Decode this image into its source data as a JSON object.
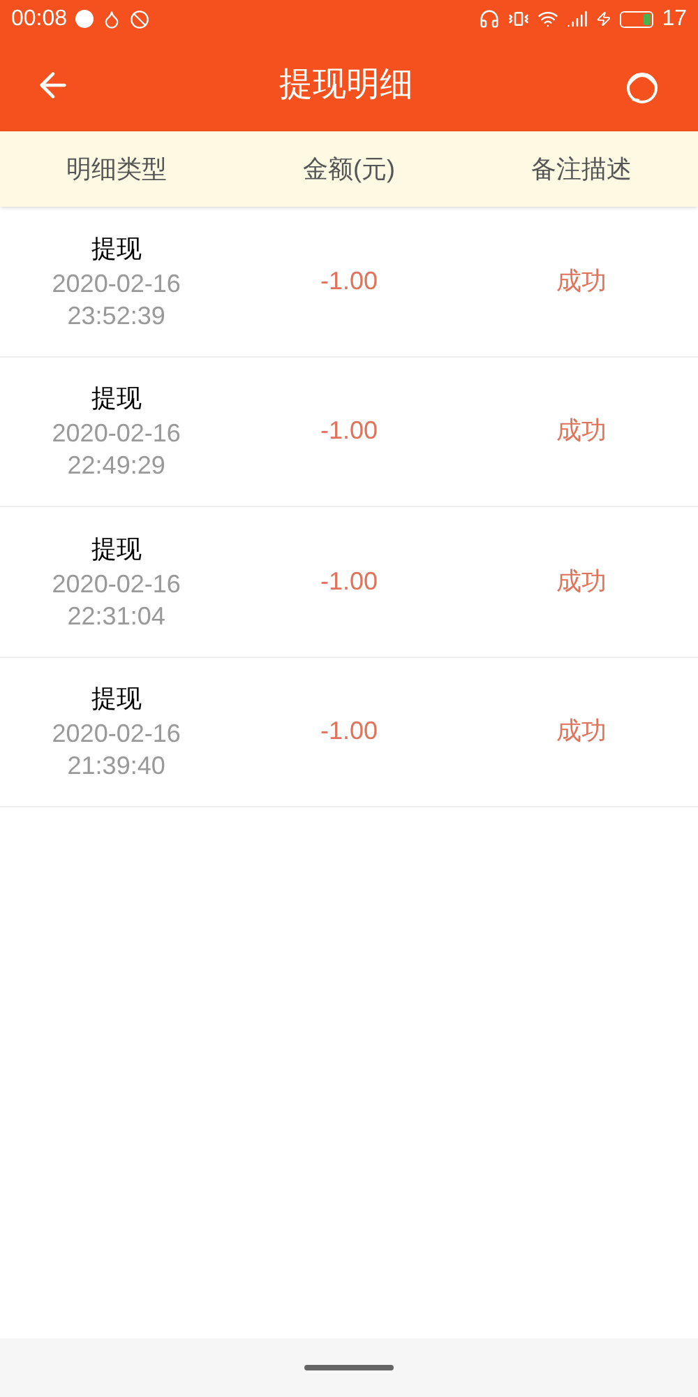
{
  "status_bar": {
    "time": "00:08",
    "battery": "17"
  },
  "header": {
    "title": "提现明细"
  },
  "table": {
    "columns": [
      "明细类型",
      "金额(元)",
      "备注描述"
    ],
    "rows": [
      {
        "type": "提现",
        "date": "2020-02-16",
        "time": "23:52:39",
        "amount": "-1.00",
        "note": "成功"
      },
      {
        "type": "提现",
        "date": "2020-02-16",
        "time": "22:49:29",
        "amount": "-1.00",
        "note": "成功"
      },
      {
        "type": "提现",
        "date": "2020-02-16",
        "time": "22:31:04",
        "amount": "-1.00",
        "note": "成功"
      },
      {
        "type": "提现",
        "date": "2020-02-16",
        "time": "21:39:40",
        "amount": "-1.00",
        "note": "成功"
      }
    ]
  }
}
